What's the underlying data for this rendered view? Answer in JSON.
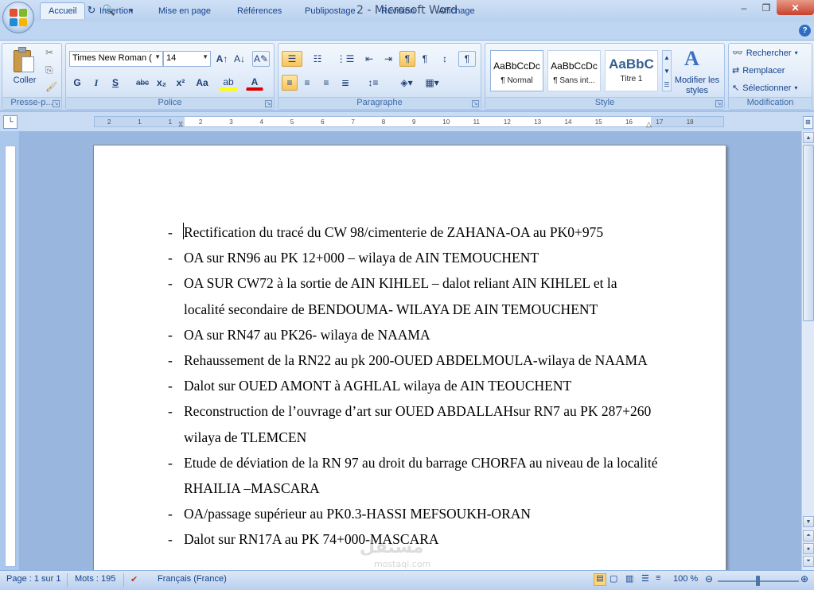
{
  "window": {
    "title": "2 - Microsoft Word",
    "minimize": "–",
    "restore": "❐",
    "close": "✕"
  },
  "tabs": [
    "Accueil",
    "Insertion",
    "Mise en page",
    "Références",
    "Publipostage",
    "Révision",
    "Affichage"
  ],
  "help_icon": "?",
  "ribbon": {
    "clipboard": {
      "paste_label": "Coller",
      "group_label": "Presse-p..."
    },
    "font": {
      "font_name": "Times New Roman (",
      "font_size": "14",
      "grow": "A↑",
      "shrink": "A↓",
      "clear": "A✎",
      "bold": "G",
      "italic": "I",
      "underline": "S",
      "strike": "abc",
      "subscript": "x₂",
      "superscript": "x²",
      "case": "Aa",
      "highlight": "ab",
      "color": "A",
      "group_label": "Police"
    },
    "paragraph": {
      "group_label": "Paragraphe"
    },
    "styles": {
      "items": [
        {
          "preview": "AaBbCcDc",
          "name": "¶ Normal"
        },
        {
          "preview": "AaBbCcDc",
          "name": "¶ Sans int..."
        },
        {
          "preview": "AaBbC",
          "name": "Titre 1"
        }
      ],
      "modify_label": "Modifier les styles",
      "group_label": "Style"
    },
    "editing": {
      "find": "Rechercher",
      "replace": "Remplacer",
      "select": "Sélectionner",
      "group_label": "Modification"
    }
  },
  "ruler_ticks": [
    "2",
    "1",
    "1",
    "2",
    "3",
    "4",
    "5",
    "6",
    "7",
    "8",
    "9",
    "10",
    "11",
    "12",
    "13",
    "14",
    "15",
    "16",
    "17",
    "18"
  ],
  "document": {
    "items": [
      "Rectification du tracé du CW 98/cimenterie de ZAHANA-OA au PK0+975",
      "OA sur RN96 au PK 12+000 – wilaya de AIN TEMOUCHENT",
      "OA SUR CW72 à la sortie de AIN KIHLEL – dalot reliant AIN KIHLEL et la localité secondaire de BENDOUMA- WILAYA DE AIN TEMOUCHENT",
      "OA sur RN47 au PK26- wilaya de NAAMA",
      "Rehaussement de la RN22 au pk 200-OUED ABDELMOULA-wilaya de NAAMA",
      "Dalot sur OUED AMONT à AGHLAL wilaya de AIN TEOUCHENT",
      "Reconstruction de l’ouvrage d’art sur OUED ABDALLAHsur RN7 au PK 287+260 wilaya de TLEMCEN",
      "Etude de déviation de la RN 97 au droit du barrage CHORFA au niveau de la localité RHAILIA –MASCARA",
      "OA/passage supérieur au PK0.3-HASSI MEFSOUKH-ORAN",
      "Dalot sur RN17A au PK 74+000-MASCARA"
    ]
  },
  "status": {
    "page": "Page : 1 sur 1",
    "words": "Mots : 195",
    "language": "Français (France)",
    "zoom": "100 %"
  },
  "watermark": "مستقل",
  "watermark_url": "mostaql.com"
}
